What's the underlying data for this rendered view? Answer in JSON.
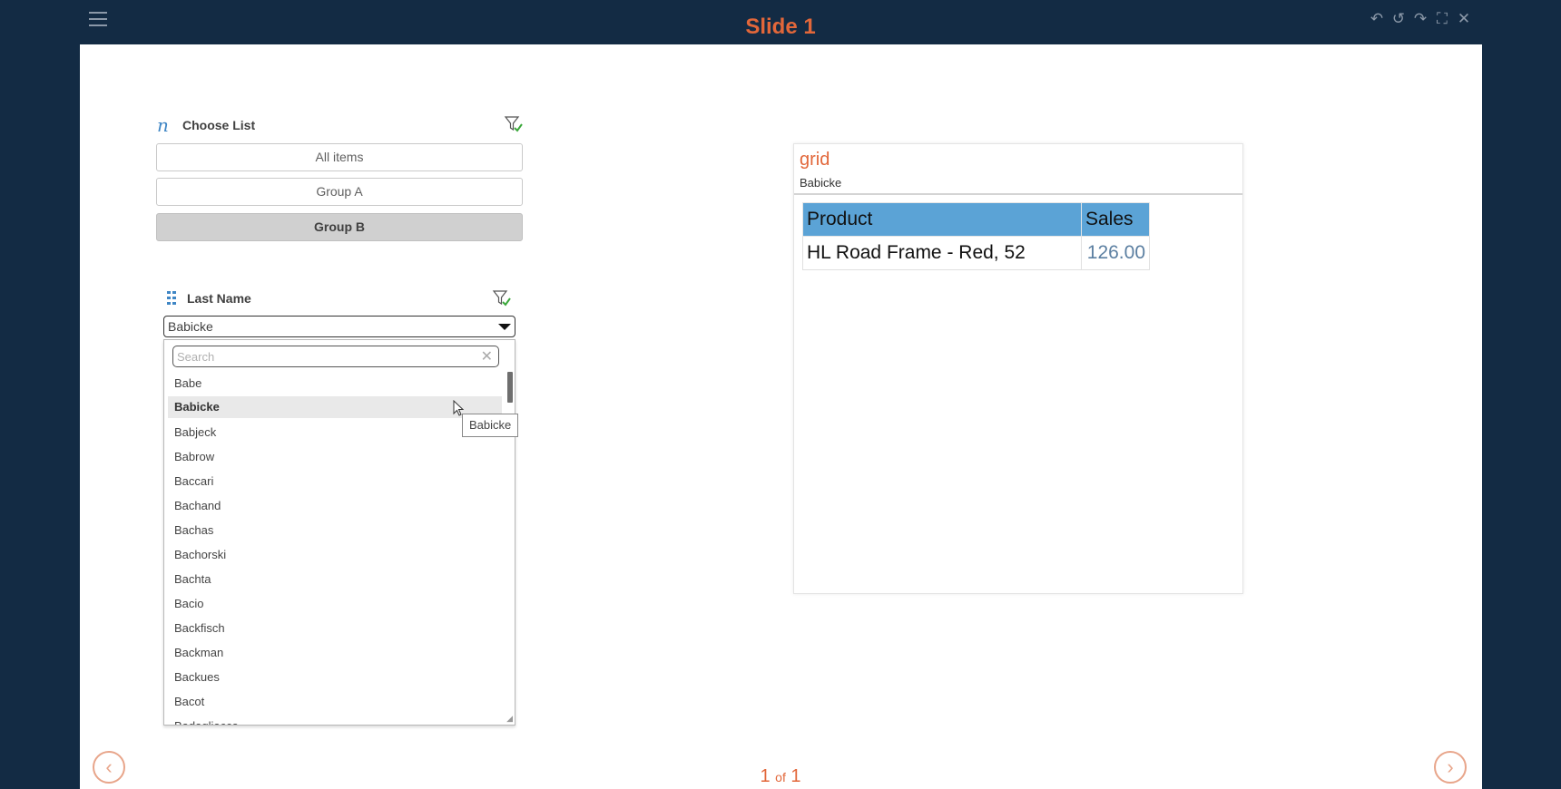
{
  "app": {
    "slide_title": "Slide 1"
  },
  "toolbar": {
    "menu_icon": "hamburger-icon",
    "tools": [
      "undo-icon",
      "undo-all-icon",
      "redo-icon",
      "fullscreen-icon",
      "close-icon"
    ]
  },
  "choose_list": {
    "title": "Choose List",
    "items": [
      {
        "label": "All items",
        "selected": false
      },
      {
        "label": "Group A",
        "selected": false
      },
      {
        "label": "Group B",
        "selected": true
      }
    ]
  },
  "last_name": {
    "title": "Last Name",
    "selected_value": "Babicke",
    "search_placeholder": "Search",
    "search_value": "",
    "options": [
      "Babe",
      "Babicke",
      "Babjeck",
      "Babrow",
      "Baccari",
      "Bachand",
      "Bachas",
      "Bachorski",
      "Bachta",
      "Bacio",
      "Backfisch",
      "Backman",
      "Backues",
      "Bacot",
      "Badagliacca"
    ],
    "hovered_tooltip": "Babicke"
  },
  "grid": {
    "title": "grid",
    "subtitle": "Babicke",
    "columns": [
      "Product",
      "Sales"
    ],
    "rows": [
      {
        "product": "HL Road Frame - Red, 52",
        "sales": "126.00"
      }
    ]
  },
  "footer": {
    "current_page": "1",
    "of_label": "of",
    "total_pages": "1"
  },
  "colors": {
    "background": "#132b44",
    "accent": "#e2673a",
    "header_blue": "#5ba3d6",
    "selected_gray": "#d0d0d0"
  }
}
